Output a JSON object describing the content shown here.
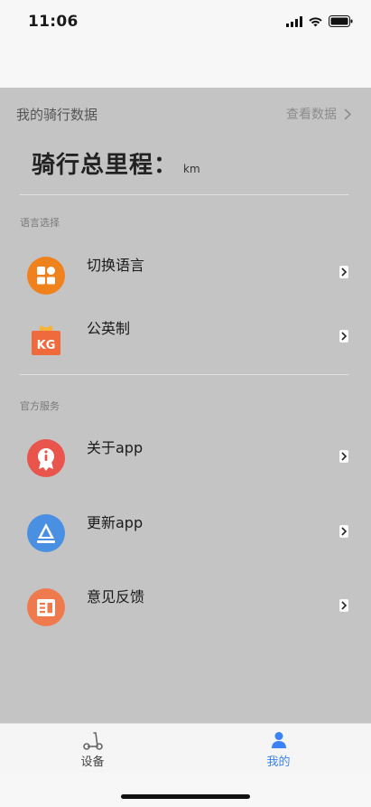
{
  "status_bar": {
    "time": "11:06"
  },
  "ride": {
    "title": "我的骑行数据",
    "view_data": "查看数据",
    "mileage_label": "骑行总里程：",
    "mileage_unit": "km"
  },
  "sections": {
    "language": {
      "label": "语言选择",
      "items": [
        {
          "label": "切换语言",
          "icon": "switch-language-icon",
          "color": "#f0821e"
        },
        {
          "label": "公英制",
          "icon": "unit-system-icon",
          "color": "#ef6a3c"
        }
      ]
    },
    "service": {
      "label": "官方服务",
      "items": [
        {
          "label": "关于app",
          "icon": "about-icon",
          "color": "#e9544c"
        },
        {
          "label": "更新app",
          "icon": "update-icon",
          "color": "#4a90e2"
        },
        {
          "label": "意见反馈",
          "icon": "feedback-icon",
          "color": "#ef7a4e"
        }
      ]
    }
  },
  "tab_bar": {
    "tabs": [
      {
        "label": "设备",
        "icon": "scooter-icon",
        "active": false
      },
      {
        "label": "我的",
        "icon": "person-icon",
        "active": true
      }
    ],
    "active_color": "#3b82f6",
    "inactive_color": "#444444"
  }
}
